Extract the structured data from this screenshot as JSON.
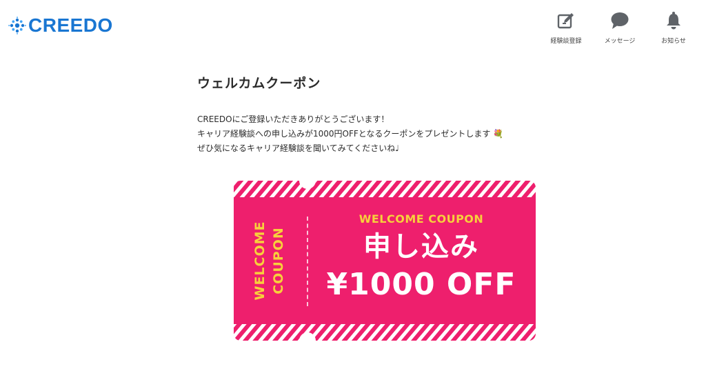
{
  "header": {
    "logo_text": "CREEDO",
    "nav": [
      {
        "label": "経験談登録",
        "icon": "edit-icon"
      },
      {
        "label": "メッセージ",
        "icon": "chat-icon"
      },
      {
        "label": "お知らせ",
        "icon": "bell-icon"
      }
    ]
  },
  "main": {
    "title": "ウェルカムクーポン",
    "message_lines": [
      "CREEDOにご登録いただきありがとうございます！",
      "キャリア経験談への申し込みが1000円OFFとなるクーポンをプレゼントします 💐",
      "ぜひ気になるキャリア経験談を聞いてみてくださいね♩"
    ]
  },
  "coupon": {
    "side_line1": "WELCOME",
    "side_line2": "COUPON",
    "subtitle": "WELCOME COUPON",
    "title": "申し込み",
    "amount": "¥1000 OFF"
  },
  "colors": {
    "brand": "#1976d2",
    "coupon_pink": "#ee1f6d",
    "coupon_yellow": "#f7d13b",
    "icon_gray": "#5f6368"
  }
}
